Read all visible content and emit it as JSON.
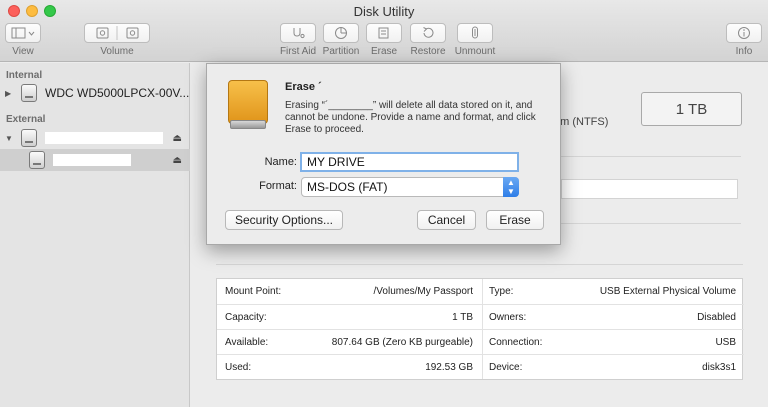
{
  "window": {
    "title": "Disk Utility"
  },
  "toolbar": {
    "view_label": "View",
    "volume_label": "Volume",
    "first_aid_label": "First Aid",
    "partition_label": "Partition",
    "erase_label": "Erase",
    "restore_label": "Restore",
    "unmount_label": "Unmount",
    "info_label": "Info"
  },
  "sidebar": {
    "internal_header": "Internal",
    "external_header": "External",
    "internal_disk": "WDC WD5000LPCX-00V...",
    "external_disk": "",
    "external_volume": ""
  },
  "main": {
    "capacity_box": "1 TB",
    "filesystem_fragment": "em (NTFS)"
  },
  "erase_sheet": {
    "title": "Erase ´",
    "message": "Erasing “´________” will delete all data stored on it, and cannot be undone. Provide a name and format, and click Erase to proceed.",
    "name_label": "Name:",
    "name_value": "MY DRIVE",
    "format_label": "Format:",
    "format_value": "MS-DOS (FAT)",
    "security_button": "Security Options...",
    "cancel_button": "Cancel",
    "erase_button": "Erase"
  },
  "info": {
    "rows": [
      {
        "left_label": "Mount Point:",
        "left_value": "/Volumes/My Passport",
        "right_label": "Type:",
        "right_value": "USB External Physical Volume"
      },
      {
        "left_label": "Capacity:",
        "left_value": "1 TB",
        "right_label": "Owners:",
        "right_value": "Disabled"
      },
      {
        "left_label": "Available:",
        "left_value": "807.64 GB (Zero KB purgeable)",
        "right_label": "Connection:",
        "right_value": "USB"
      },
      {
        "left_label": "Used:",
        "left_value": "192.53 GB",
        "right_label": "Device:",
        "right_value": "disk3s1"
      }
    ]
  },
  "colors": {
    "accent": "#2e7ee8",
    "close": "#fc605b",
    "minimize": "#fdbc40",
    "maximize": "#34c84a",
    "drive": "#f0a92c"
  }
}
